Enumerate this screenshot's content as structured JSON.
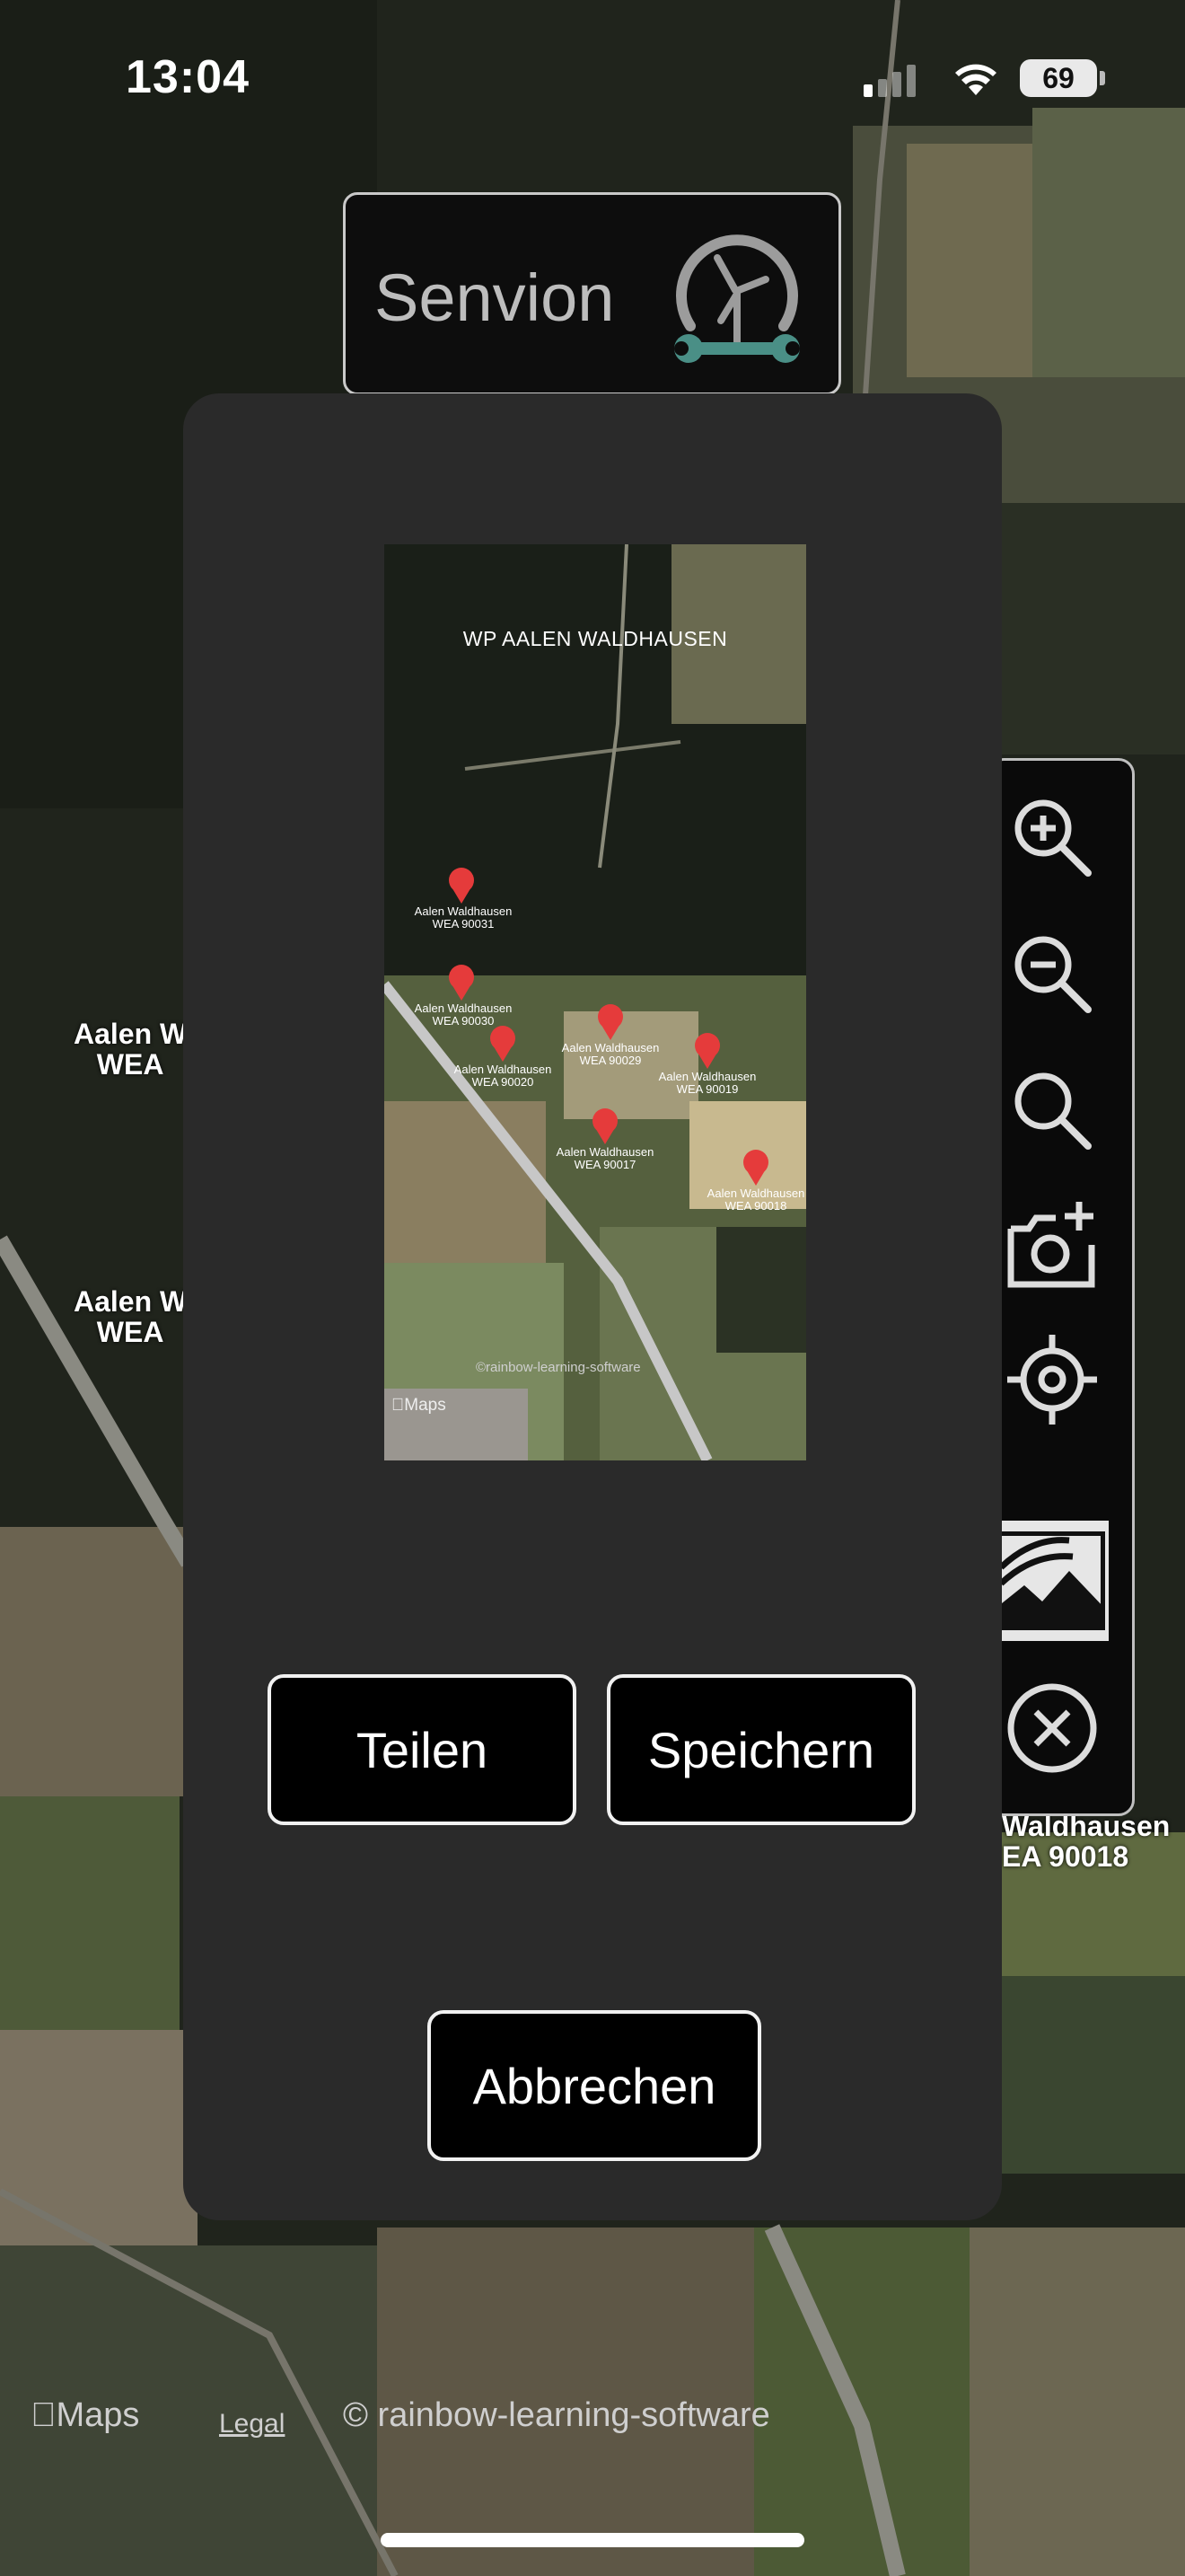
{
  "status_bar": {
    "time": "13:04",
    "battery": "69"
  },
  "logo": {
    "text": "Senvion",
    "icon": "wind-turbine-wrench-icon"
  },
  "map": {
    "labels": [
      {
        "line1": "Aalen W",
        "line2": "WEA"
      },
      {
        "line1": "Aalen W",
        "line2": "WEA"
      },
      {
        "line1": "Waldhausen",
        "line2": "EA 90018"
      }
    ],
    "attribution_logo": "Maps",
    "legal": "Legal",
    "copyright": "© rainbow-learning-software"
  },
  "toolbar": {
    "tools": [
      {
        "icon": "zoom-in-icon"
      },
      {
        "icon": "zoom-out-icon"
      },
      {
        "icon": "search-icon"
      },
      {
        "icon": "camera-add-icon"
      },
      {
        "icon": "locate-icon"
      },
      {
        "icon": "map-image-icon",
        "active": true
      },
      {
        "icon": "close-circle-icon"
      }
    ]
  },
  "dialog": {
    "preview": {
      "title": "WP AALEN WALDHAUSEN",
      "pins": [
        {
          "line1": "Aalen Waldhausen",
          "line2": "WEA 90031"
        },
        {
          "line1": "Aalen Waldhausen",
          "line2": "WEA 90030"
        },
        {
          "line1": "Aalen Waldhausen",
          "line2": "WEA 90020"
        },
        {
          "line1": "Aalen Waldhausen",
          "line2": "WEA 90029"
        },
        {
          "line1": "Aalen Waldhausen",
          "line2": "WEA 90019"
        },
        {
          "line1": "Aalen Waldhausen",
          "line2": "WEA 90017"
        },
        {
          "line1": "Aalen Waldhausen",
          "line2": "WEA 90018"
        }
      ],
      "copyright": "©rainbow-learning-software",
      "maps_logo": "Maps"
    },
    "share_label": "Teilen",
    "save_label": "Speichern",
    "cancel_label": "Abbrechen"
  },
  "colors": {
    "accent": "#4a8f86",
    "pin": "#e53b3b"
  }
}
